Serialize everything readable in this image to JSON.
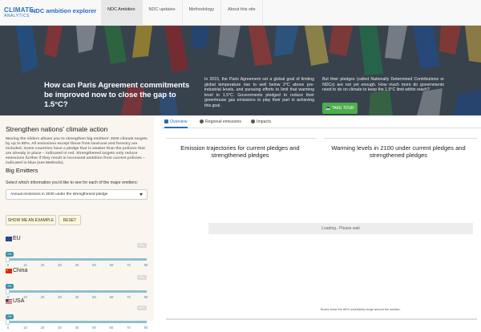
{
  "header": {
    "logo_line1": "CLIMATE",
    "logo_line2": "ANALYTICS",
    "app_name": "NDC ambition explorer",
    "nav": [
      "NDC Ambition",
      "NDC updates",
      "Methodology",
      "About this site"
    ]
  },
  "hero": {
    "title": "How can Paris Agreement commitments be improved now to close the gap to 1.5°C?",
    "paragraph1": "In 2015, the Paris Agreement set a global goal of limiting global temperature rise to well below 2°C above pre-industrial levels, and pursuing efforts to limit that warming level to 1.5°C. Governments pledged to reduce their greenhouse gas emissions to play their part in achieving this goal.",
    "paragraph2": "But their pledges (called Nationally Determined Contributions or NDCs) are not yet enough. How much more do governments need to do on climate to keep the 1.5°C limit within reach?",
    "tour_button": "TAKE TOUR"
  },
  "left_panel": {
    "title": "Strengthen nations' climate action",
    "description": "Moving the sliders allows you to strengthen big emitters' 2030 climate targets by up to 80%. All emissions except those from land-use and forestry are included. Some countries have a pledge that is weaker than the policies that are already in place – indicated in red. Strengthened targets only reduce emissions further if they result in increased ambition from current policies – indicated in blue (see Methods).",
    "subtitle": "Big Emitters",
    "select_label": "Select which information you'd like to see for each of the major emitters:",
    "select_value": "Annual emissions in 2030 under the strengthened pledge",
    "example_button": "SHOW ME AN EXAMPLE",
    "reset_button": "RESET",
    "slider_ticks": [
      "0",
      "10",
      "20",
      "30",
      "40",
      "50",
      "60",
      "70",
      "80"
    ],
    "countries": [
      {
        "name": "EU",
        "current": "0%",
        "max": "80%",
        "value": 0
      },
      {
        "name": "China",
        "current": "0%",
        "max": "80%",
        "value": 0
      },
      {
        "name": "USA",
        "current": "0%",
        "max": "80%",
        "value": 0
      }
    ]
  },
  "tabs": [
    "Overview",
    "Regional emissions",
    "Impacts"
  ],
  "charts": {
    "emissions_title": "Emission trajectories for current pledges and strengthened pledges",
    "warming_title": "Warming levels in 2100 under current pledges and strengthened pledges",
    "loading": "Loading.. Please wait",
    "footnote": "Boxes show the 66% uncertainty range around the median."
  },
  "colors": {
    "accent": "#2a6ebb",
    "slider": "#3a8fa8",
    "tour_button": "#4cae4c",
    "left_panel_bg": "#fbf5ef"
  }
}
